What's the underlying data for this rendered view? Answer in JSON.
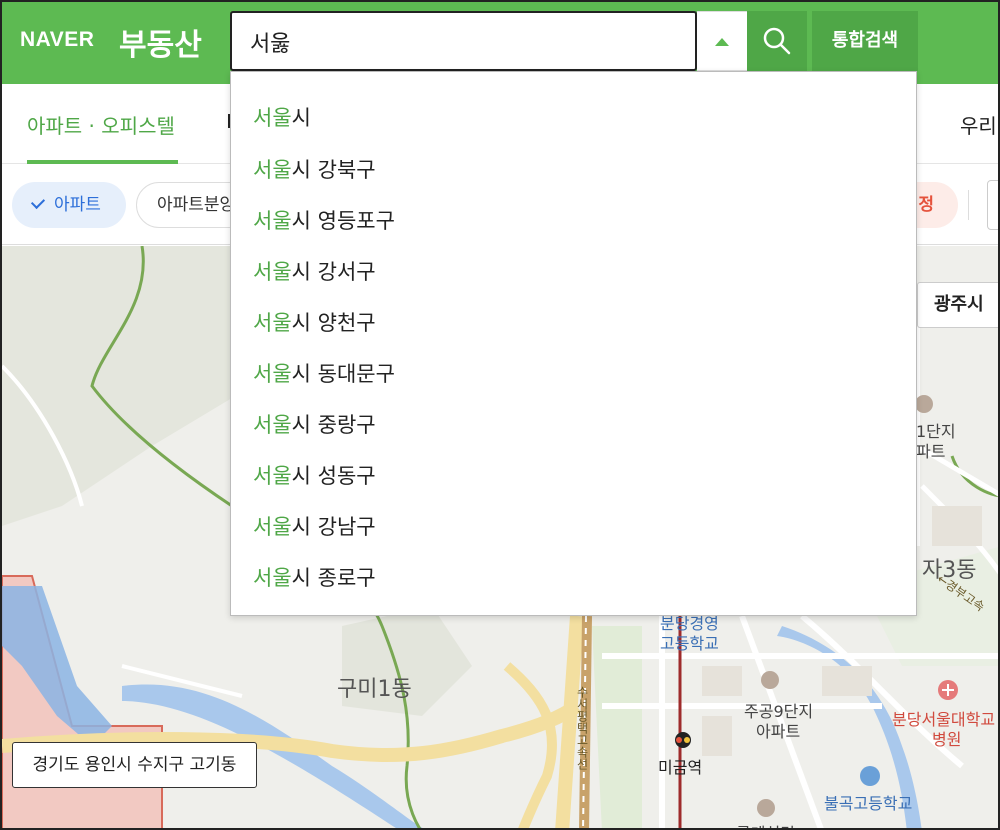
{
  "header": {
    "logo": "NAVER",
    "service": "부동산",
    "search_value": "서욿",
    "total_search_label": "통합검색",
    "search_icon": "search-icon",
    "toggle_icon": "caret-up-icon",
    "brand_color": "#5dba52"
  },
  "tabs": {
    "active": "아파트 · 오피스텔",
    "right": "우리"
  },
  "filters": {
    "apartment": "아파트",
    "presale": "아파트분양",
    "red_chip": "정"
  },
  "autocomplete": {
    "highlight": "서울",
    "items": [
      {
        "hl": "서울",
        "rest": "시"
      },
      {
        "hl": "서울",
        "rest": "시 강북구"
      },
      {
        "hl": "서울",
        "rest": "시 영등포구"
      },
      {
        "hl": "서울",
        "rest": "시 강서구"
      },
      {
        "hl": "서울",
        "rest": "시 양천구"
      },
      {
        "hl": "서울",
        "rest": "시 동대문구"
      },
      {
        "hl": "서울",
        "rest": "시 중랑구"
      },
      {
        "hl": "서울",
        "rest": "시 성동구"
      },
      {
        "hl": "서울",
        "rest": "시 강남구"
      },
      {
        "hl": "서울",
        "rest": "시 종로구"
      }
    ]
  },
  "map": {
    "gwangju": "광주시",
    "location": "경기도 용인시 수지구 고기동",
    "labels": {
      "gumi": "구미1동",
      "apt1a": "1단지",
      "apt1b": "파트",
      "ja3": "자3동",
      "road_right": "←경부고속",
      "school1a": "분당경영",
      "school1b": "고등학교",
      "apt9a": "주공9단지",
      "apt9b": "아파트",
      "station": "미금역",
      "hospital_a": "분당서울대학교",
      "hospital_b": "병원",
      "school2": "불곡고등학교",
      "bottom": "롯데설경",
      "road_vertical": "수서평택고속선"
    }
  }
}
